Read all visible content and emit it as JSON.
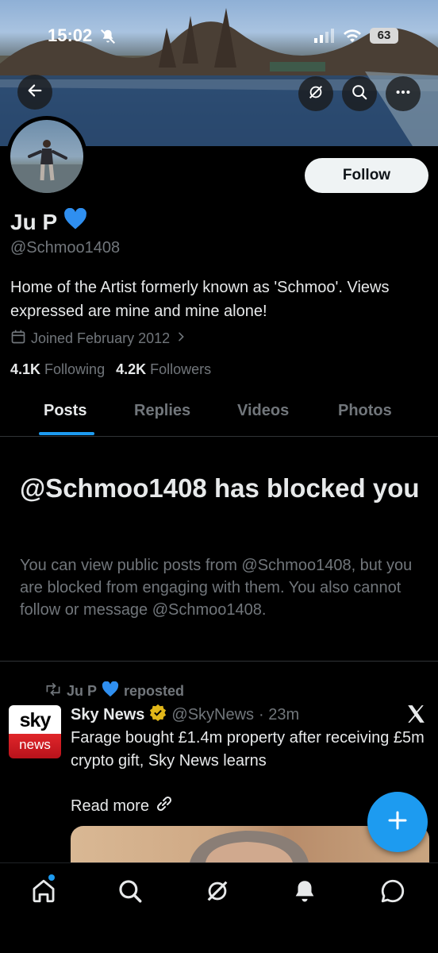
{
  "status_bar": {
    "time": "15:02",
    "battery": "63"
  },
  "profile": {
    "display_name": "Ju P",
    "handle": "@Schmoo1408",
    "bio": "Home of the Artist formerly known as 'Schmoo'. Views expressed are mine and mine alone!",
    "joined": "Joined February 2012",
    "following_count": "4.1K",
    "following_label": "Following",
    "followers_count": "4.2K",
    "followers_label": "Followers",
    "follow_button": "Follow"
  },
  "tabs": [
    {
      "label": "Posts",
      "active": true
    },
    {
      "label": "Replies",
      "active": false
    },
    {
      "label": "Videos",
      "active": false
    },
    {
      "label": "Photos",
      "active": false
    }
  ],
  "blocked": {
    "title": "@Schmoo1408 has blocked you",
    "description": "You can view public posts from @Schmoo1408, but you are blocked from engaging with them. You also cannot follow or message @Schmoo1408."
  },
  "post": {
    "repost_by": "Ju P",
    "repost_label": "reposted",
    "logo_top": "sky",
    "logo_bottom": "news",
    "author": "Sky News",
    "author_handle": "@SkyNews",
    "time": "· 23m",
    "text": "Farage bought £1.4m property after receiving £5m crypto gift, Sky News learns",
    "read_more": "Read more"
  },
  "colors": {
    "accent": "#1d9bf0",
    "muted": "#71767b",
    "background": "#000000",
    "verified_gold": "#e2b719"
  },
  "icons": {
    "nav": [
      "home-icon",
      "search-icon",
      "grok-icon",
      "notifications-icon",
      "messages-icon"
    ]
  }
}
